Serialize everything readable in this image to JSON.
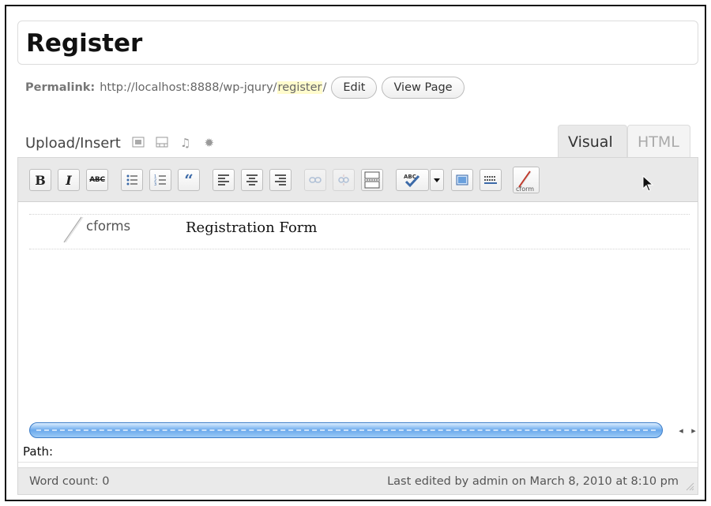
{
  "title": "Register",
  "permalink": {
    "label": "Permalink:",
    "base_url": "http://localhost:8888/wp-jqury/",
    "slug": "register",
    "trailing": "/",
    "edit_label": "Edit",
    "view_label": "View Page"
  },
  "media": {
    "label": "Upload/Insert",
    "icons": [
      "image-icon",
      "video-icon",
      "audio-icon",
      "media-icon"
    ]
  },
  "tabs": {
    "visual": "Visual",
    "html": "HTML",
    "active": "Visual"
  },
  "toolbar": {
    "bold": "B",
    "italic": "I",
    "strike": "ABC",
    "blockquote": "“",
    "buttons": [
      "bold",
      "italic",
      "strikethrough",
      "bullet-list",
      "numbered-list",
      "blockquote",
      "align-left",
      "align-center",
      "align-right",
      "link",
      "unlink",
      "more-tag",
      "spellcheck",
      "spellcheck-dropdown",
      "fullscreen",
      "kitchen-sink",
      "cforms"
    ],
    "cforms_button_text": "cform"
  },
  "content": {
    "shortcode_label": "cforms",
    "form_title": "Registration Form"
  },
  "path_label": "Path:",
  "status": {
    "word_count": "Word count: 0",
    "last_edited": "Last edited by admin on March 8, 2010 at 8:10 pm"
  },
  "colors": {
    "slug_highlight": "#fffbcc",
    "scrollbar": "#6aa9ec",
    "quote_blue": "#3c6aa8"
  }
}
